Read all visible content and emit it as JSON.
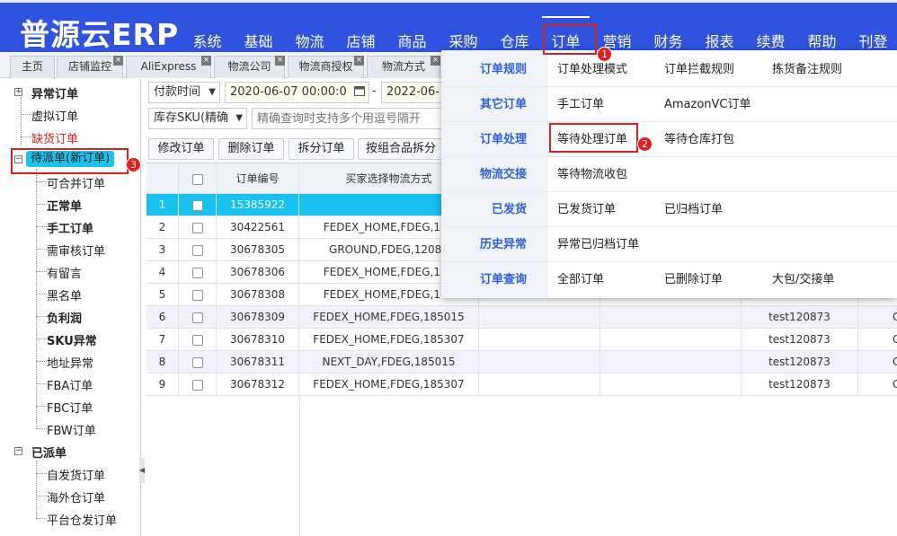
{
  "app": {
    "logo": "普源云ERP"
  },
  "nav": [
    "系统",
    "基础",
    "物流",
    "店铺",
    "商品",
    "采购",
    "仓库",
    "订单",
    "营销",
    "财务",
    "报表",
    "续费",
    "帮助",
    "刊登"
  ],
  "tabs": [
    {
      "label": "主页",
      "closable": false
    },
    {
      "label": "店铺监控",
      "closable": true
    },
    {
      "label": "AliExpress",
      "closable": true
    },
    {
      "label": "物流公司",
      "closable": true
    },
    {
      "label": "物流商授权",
      "closable": true
    },
    {
      "label": "物流方式",
      "closable": true
    }
  ],
  "sidebar": {
    "groups": [
      {
        "label": "异常订单",
        "expander": "+"
      },
      {
        "label": "虚拟订单"
      },
      {
        "label": "缺货订单"
      },
      {
        "label": "待派单(新订单)",
        "expander": "−"
      },
      {
        "label": "可合并订单"
      },
      {
        "label": "正常单"
      },
      {
        "label": "手工订单"
      },
      {
        "label": "需审核订单"
      },
      {
        "label": "有留言"
      },
      {
        "label": "黑名单"
      },
      {
        "label": "负利润"
      },
      {
        "label": "SKU异常"
      },
      {
        "label": "地址异常"
      },
      {
        "label": "FBA订单"
      },
      {
        "label": "FBC订单"
      },
      {
        "label": "FBW订单"
      },
      {
        "label": "已派单",
        "expander": "−"
      },
      {
        "label": "自发货订单"
      },
      {
        "label": "海外仓订单"
      },
      {
        "label": "平台仓发订单"
      }
    ],
    "collapse_glyph": "◀"
  },
  "filters": {
    "time_type": "付款时间",
    "date_from": "2020-06-07 00:00:0",
    "date_sep": "-",
    "date_to": "2022-06-",
    "sku_type": "库存SKU(精确",
    "search_placeholder": "精确查询时支持多个用逗号隔开"
  },
  "toolbar": [
    "修改订单",
    "删除订单",
    "拆分订单",
    "按组合品拆分"
  ],
  "grid": {
    "columns": [
      "",
      "订单编号",
      "买家选择物流方式"
    ],
    "rows": [
      {
        "n": "1",
        "id": "15385922",
        "logistics": "",
        "store": "",
        "extra": ""
      },
      {
        "n": "2",
        "id": "30422561",
        "logistics": "FEDEX_HOME,FDEG,120",
        "store": "",
        "extra": ""
      },
      {
        "n": "3",
        "id": "30678305",
        "logistics": "GROUND,FDEG,12087",
        "store": "",
        "extra": ""
      },
      {
        "n": "4",
        "id": "30678306",
        "logistics": "FEDEX_HOME,FDEG,185",
        "store": "",
        "extra": ""
      },
      {
        "n": "5",
        "id": "30678308",
        "logistics": "FEDEX_HOME,FDEG,185",
        "store": "",
        "extra": ""
      },
      {
        "n": "6",
        "id": "30678309",
        "logistics": "FEDEX_HOME,FDEG,185015",
        "store": "test120873",
        "extra": "C"
      },
      {
        "n": "7",
        "id": "30678310",
        "logistics": "FEDEX_HOME,FDEG,185307",
        "store": "test120873",
        "extra": "C"
      },
      {
        "n": "8",
        "id": "30678311",
        "logistics": "NEXT_DAY,FDEG,185015",
        "store": "test120873",
        "extra": "C"
      },
      {
        "n": "9",
        "id": "30678312",
        "logistics": "FEDEX_HOME,FDEG,185307",
        "store": "test120873",
        "extra": "C"
      }
    ]
  },
  "dropdown": [
    {
      "category": "订单规则",
      "links": [
        "订单处理模式",
        "订单拦截规则",
        "拣货备注规则"
      ]
    },
    {
      "category": "其它订单",
      "links": [
        "手工订单",
        "AmazonVC订单"
      ]
    },
    {
      "category": "订单处理",
      "links": [
        "等待处理订单",
        "等待仓库打包"
      ]
    },
    {
      "category": "物流交接",
      "links": [
        "等待物流收包"
      ]
    },
    {
      "category": "已发货",
      "links": [
        "已发货订单",
        "已归档订单"
      ]
    },
    {
      "category": "历史异常",
      "links": [
        "异常已归档订单"
      ]
    },
    {
      "category": "订单查询",
      "links": [
        "全部订单",
        "已删除订单",
        "大包/交接单"
      ]
    }
  ],
  "annotations": [
    "1",
    "2",
    "3"
  ],
  "icons": {
    "calendar": "calendar-icon",
    "caret": "caret-down-icon",
    "close": "close-icon"
  },
  "colors": {
    "header": "#2f53df",
    "selected_row": "#17c1f0",
    "highlight_box": "#e02020",
    "category_text": "#2f5fd6"
  }
}
